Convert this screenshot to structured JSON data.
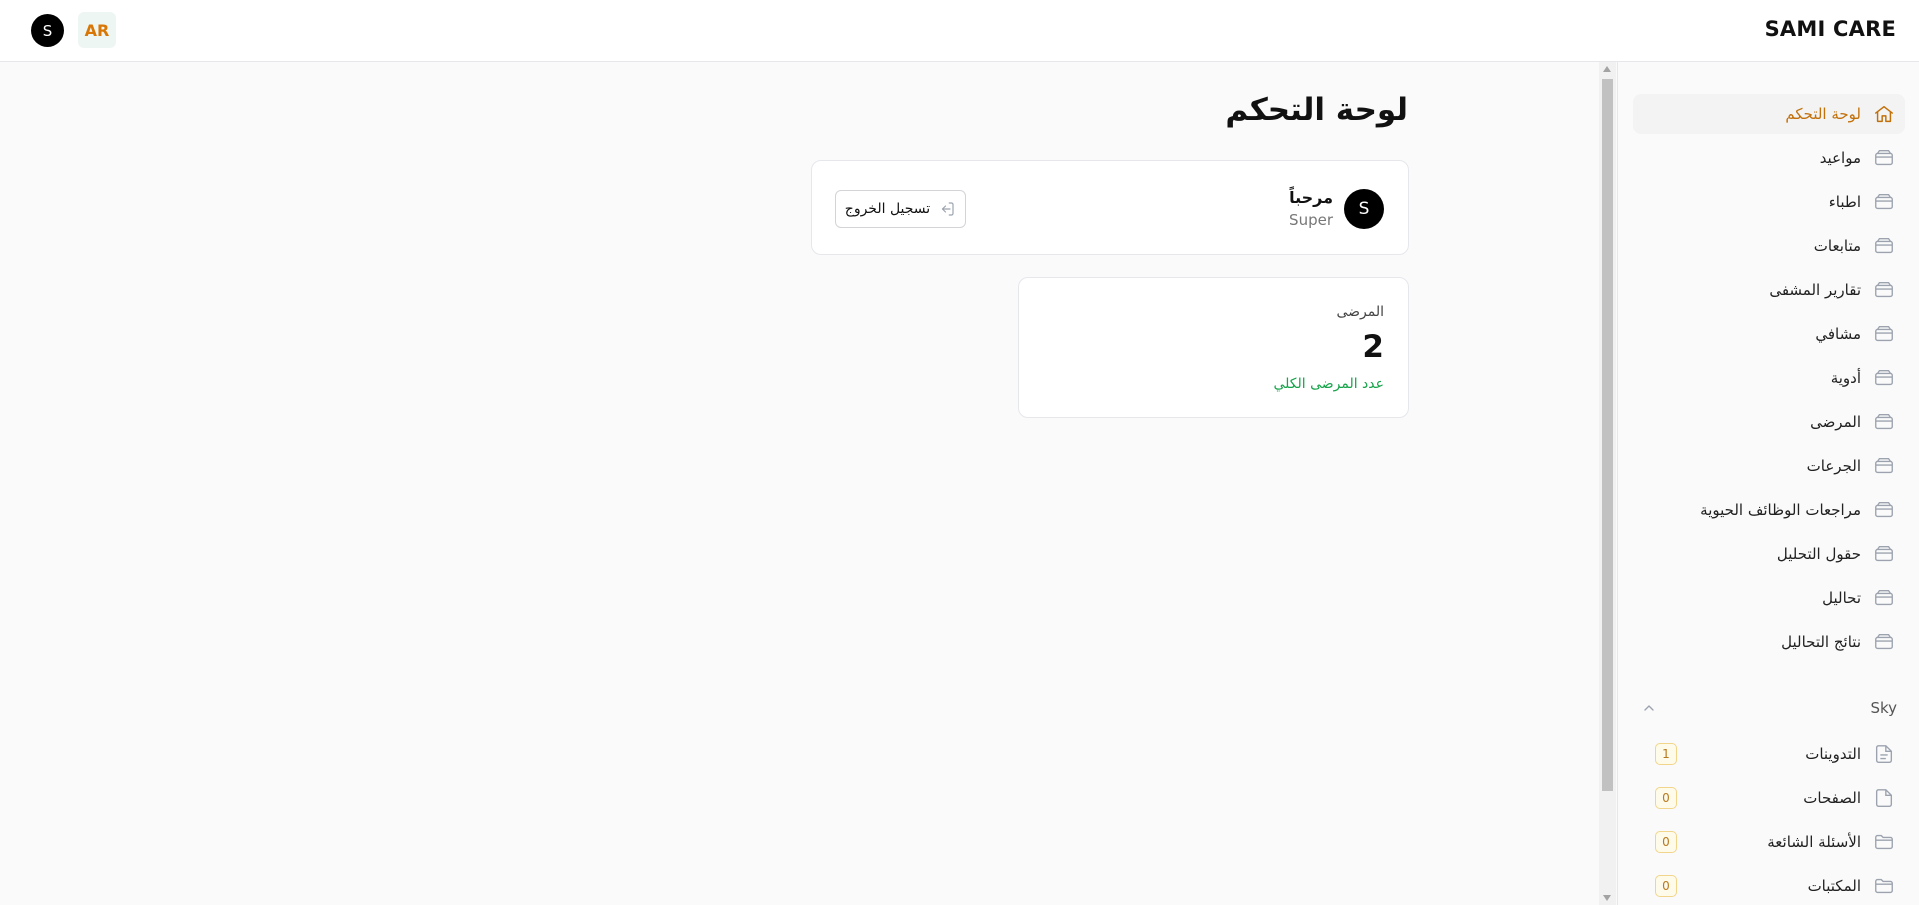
{
  "topbar": {
    "brand": "SAMI CARE",
    "avatar_initial": "S",
    "lang": "AR"
  },
  "sidebar": {
    "items": [
      {
        "label": "لوحة التحكم",
        "icon": "home-icon",
        "active": true
      },
      {
        "label": "مواعيد",
        "icon": "table-icon"
      },
      {
        "label": "اطباء",
        "icon": "table-icon"
      },
      {
        "label": "متابعات",
        "icon": "table-icon"
      },
      {
        "label": "تقارير المشفى",
        "icon": "table-icon"
      },
      {
        "label": "مشافي",
        "icon": "table-icon"
      },
      {
        "label": "أدوية",
        "icon": "table-icon"
      },
      {
        "label": "المرضى",
        "icon": "table-icon"
      },
      {
        "label": "الجرعات",
        "icon": "table-icon"
      },
      {
        "label": "مراجعات الوظائف الحيوية",
        "icon": "table-icon"
      },
      {
        "label": "حقول التحليل",
        "icon": "table-icon"
      },
      {
        "label": "تحاليل",
        "icon": "table-icon"
      },
      {
        "label": "نتائج التحاليل",
        "icon": "table-icon"
      }
    ],
    "group": {
      "title": "Sky",
      "items": [
        {
          "label": "التدوينات",
          "icon": "document-text-icon",
          "count": "1"
        },
        {
          "label": "الصفحات",
          "icon": "document-icon",
          "count": "0"
        },
        {
          "label": "الأسئلة الشائعة",
          "icon": "folder-icon",
          "count": "0"
        },
        {
          "label": "المكتبات",
          "icon": "folder-icon",
          "count": "0"
        }
      ]
    }
  },
  "main": {
    "title": "لوحة التحكم",
    "welcome": {
      "greeting": "مرحباً",
      "role": "Super",
      "avatar_initial": "S",
      "logout_label": "تسجيل الخروج"
    },
    "stats": [
      {
        "label": "المرضى",
        "value": "2",
        "description": "عدد المرضى الكلي"
      }
    ]
  },
  "colors": {
    "accent": "#c2700a",
    "success": "#16a34a",
    "badge_text": "#b7791f"
  }
}
